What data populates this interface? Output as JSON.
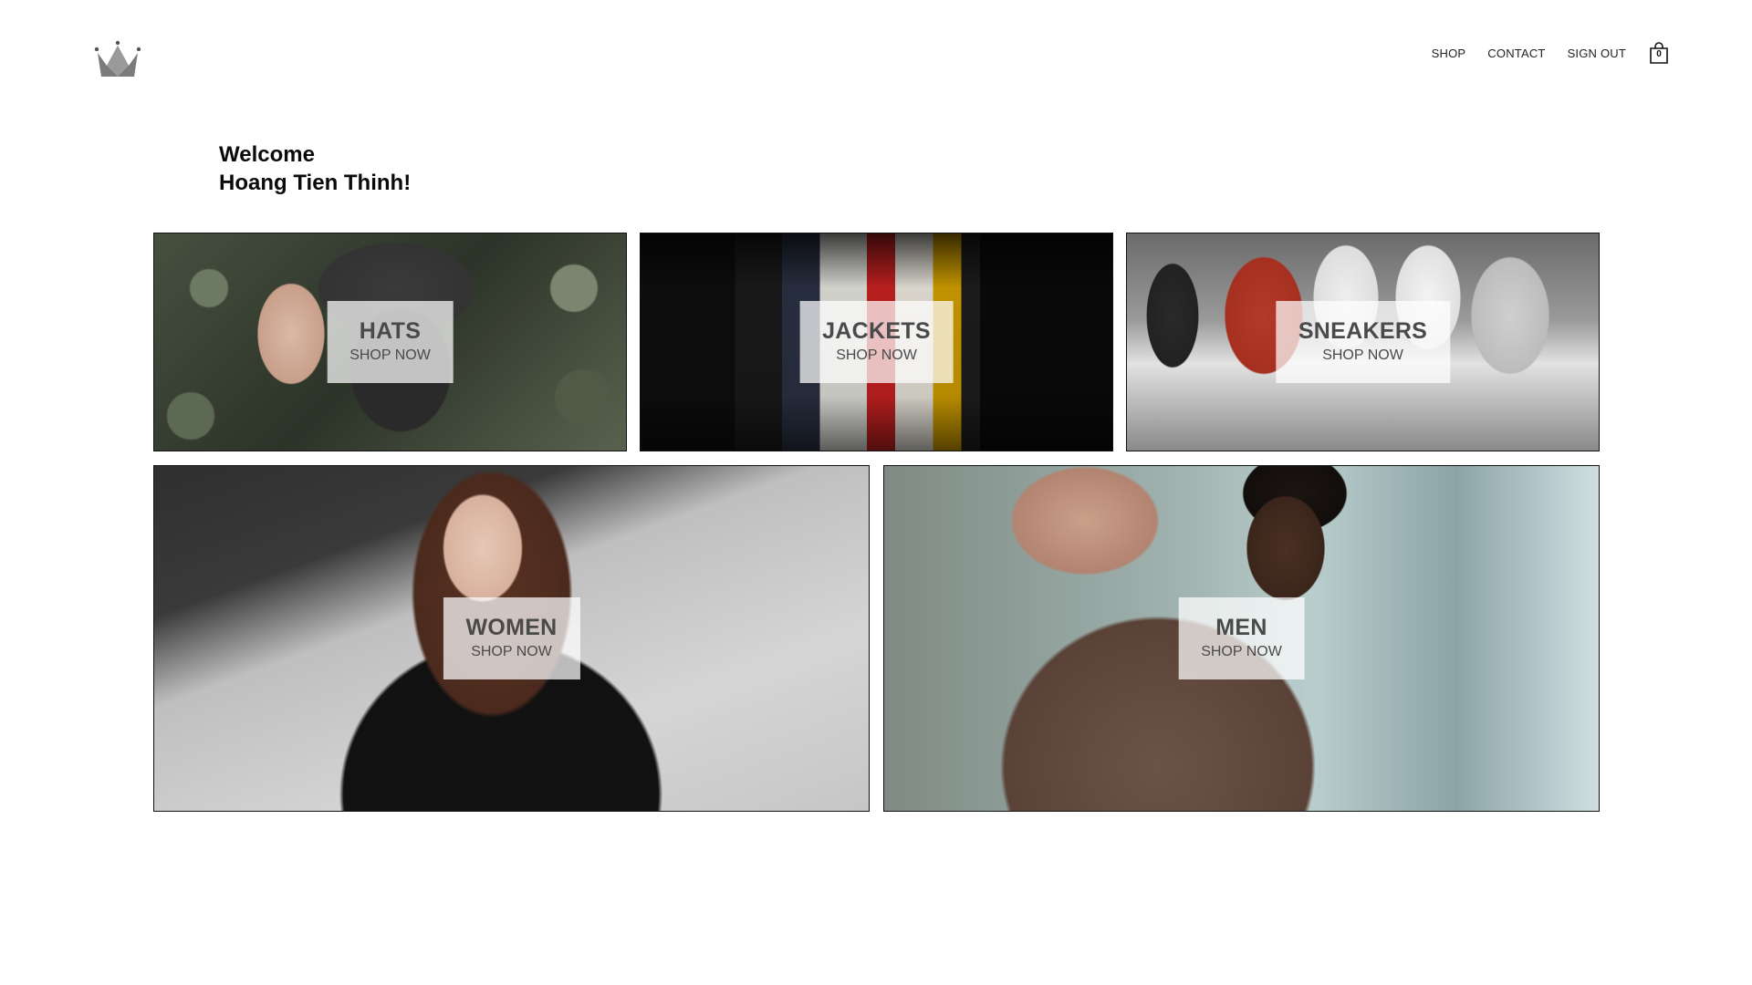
{
  "header": {
    "logo_icon": "crown-icon",
    "nav": [
      {
        "label": "SHOP"
      },
      {
        "label": "CONTACT"
      },
      {
        "label": "SIGN OUT"
      }
    ],
    "cart": {
      "icon": "shopping-bag-icon",
      "count": "0"
    }
  },
  "welcome": {
    "line1": "Welcome",
    "line2": "Hoang Tien Thinh!"
  },
  "directory": [
    {
      "title": "HATS",
      "subtitle": "SHOP NOW"
    },
    {
      "title": "JACKETS",
      "subtitle": "SHOP NOW"
    },
    {
      "title": "SNEAKERS",
      "subtitle": "SHOP NOW"
    },
    {
      "title": "WOMEN",
      "subtitle": "SHOP NOW"
    },
    {
      "title": "MEN",
      "subtitle": "SHOP NOW"
    }
  ]
}
